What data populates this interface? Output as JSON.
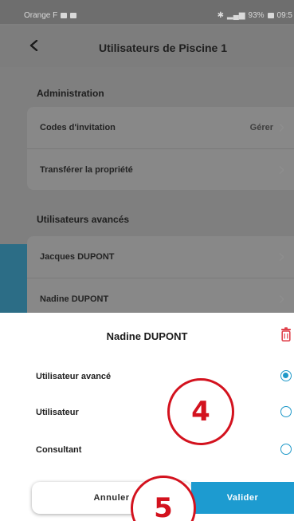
{
  "status_bar": {
    "carrier": "Orange F",
    "battery": "93%",
    "time": "09:5"
  },
  "navbar": {
    "title": "Utilisateurs de Piscine 1"
  },
  "administration": {
    "title": "Administration",
    "items": [
      {
        "label": "Codes d'invitation",
        "value": "Gérer"
      },
      {
        "label": "Transférer la propriété",
        "value": ""
      }
    ]
  },
  "advanced_users": {
    "title": "Utilisateurs avancés",
    "items": [
      {
        "label": "Jacques DUPONT"
      },
      {
        "label": "Nadine DUPONT"
      }
    ]
  },
  "sheet": {
    "title": "Nadine DUPONT",
    "options": [
      {
        "label": "Utilisateur avancé",
        "selected": true
      },
      {
        "label": "Utilisateur",
        "selected": false
      },
      {
        "label": "Consultant",
        "selected": false
      }
    ],
    "cancel_label": "Annuler",
    "validate_label": "Valider"
  },
  "annotations": {
    "step_4": "4",
    "step_5": "5"
  },
  "colors": {
    "accent": "#1d9bd0",
    "annotation": "#d3121e",
    "delete": "#e0434d"
  },
  "icons": {
    "back": "chevron-left-icon",
    "delete": "trash-icon",
    "row_chevron": "chevron-right-icon"
  }
}
